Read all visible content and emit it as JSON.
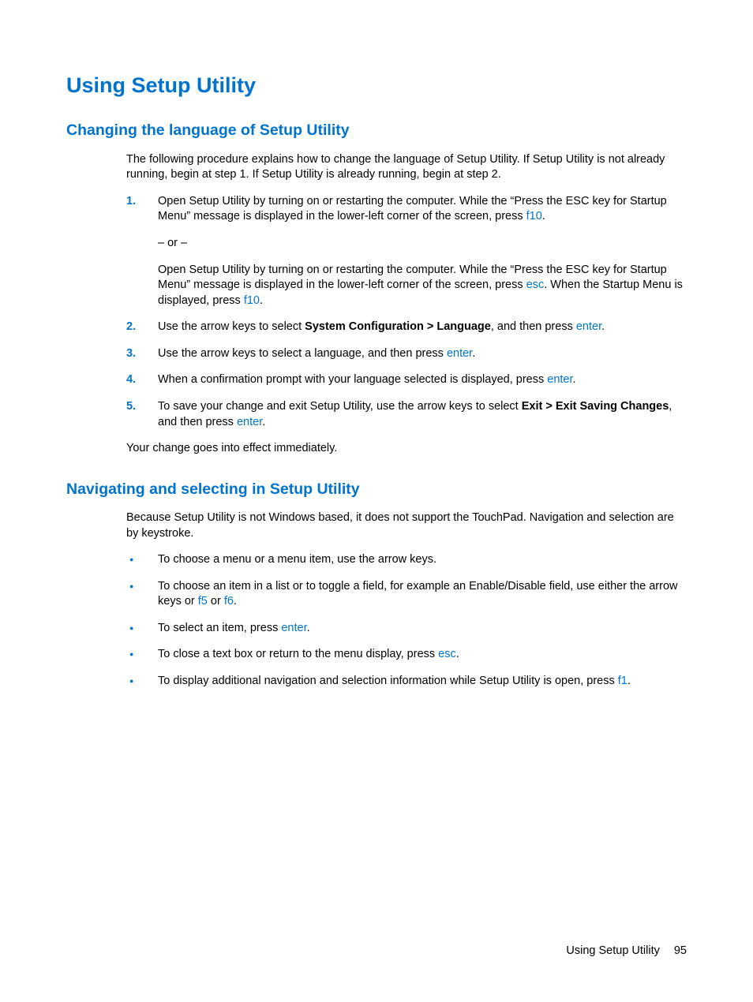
{
  "page": {
    "title": "Using Setup Utility",
    "section1": {
      "heading": "Changing the language of Setup Utility",
      "intro": "The following procedure explains how to change the language of Setup Utility. If Setup Utility is not already running, begin at step 1. If Setup Utility is already running, begin at step 2.",
      "step1": {
        "num": "1.",
        "t1": "Open Setup Utility by turning on or restarting the computer. While the “Press the ESC key for Startup Menu” message is displayed in the lower-left corner of the screen, press ",
        "k1": "f10",
        "t2": ".",
        "or": "– or –",
        "t3": "Open Setup Utility by turning on or restarting the computer. While the “Press the ESC key for Startup Menu” message is displayed in the lower-left corner of the screen, press ",
        "k2": "esc",
        "t4": ". When the Startup Menu is displayed, press ",
        "k3": "f10",
        "t5": "."
      },
      "step2": {
        "num": "2.",
        "t1": "Use the arrow keys to select ",
        "b1": "System Configuration > Language",
        "t2": ", and then press ",
        "k1": "enter",
        "t3": "."
      },
      "step3": {
        "num": "3.",
        "t1": "Use the arrow keys to select a language, and then press ",
        "k1": "enter",
        "t2": "."
      },
      "step4": {
        "num": "4.",
        "t1": "When a confirmation prompt with your language selected is displayed, press ",
        "k1": "enter",
        "t2": "."
      },
      "step5": {
        "num": "5.",
        "t1": "To save your change and exit Setup Utility, use the arrow keys to select ",
        "b1": "Exit > Exit Saving Changes",
        "t2": ", and then press ",
        "k1": "enter",
        "t3": "."
      },
      "outro": "Your change goes into effect immediately."
    },
    "section2": {
      "heading": "Navigating and selecting in Setup Utility",
      "intro": "Because Setup Utility is not Windows based, it does not support the TouchPad. Navigation and selection are by keystroke.",
      "b1": "To choose a menu or a menu item, use the arrow keys.",
      "b2": {
        "t1": "To choose an item in a list or to toggle a field, for example an Enable/Disable field, use either the arrow keys or ",
        "k1": "f5",
        "t2": " or ",
        "k2": "f6",
        "t3": "."
      },
      "b3": {
        "t1": "To select an item, press ",
        "k1": "enter",
        "t2": "."
      },
      "b4": {
        "t1": "To close a text box or return to the menu display, press ",
        "k1": "esc",
        "t2": "."
      },
      "b5": {
        "t1": "To display additional navigation and selection information while Setup Utility is open, press ",
        "k1": "f1",
        "t2": "."
      }
    },
    "footer": {
      "label": "Using Setup Utility",
      "page_number": "95"
    }
  }
}
